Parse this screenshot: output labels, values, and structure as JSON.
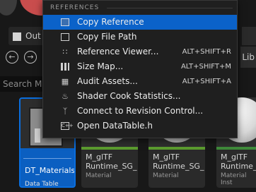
{
  "background": {
    "tab_label": "Out",
    "search_label": "Search M",
    "right_label": "Lib"
  },
  "tiles": [
    {
      "name": "DT_Materials",
      "type": "Data Table (OK..."
    },
    {
      "name": "M_glTF\nRuntime_SG_",
      "type": "Material"
    },
    {
      "name": "M_glTF\nRuntime_SG_",
      "type": "Material"
    },
    {
      "name": "M_glTF\nRuntime_",
      "type": "Material Inst"
    }
  ],
  "menu": {
    "header": "REFERENCES",
    "items": [
      {
        "label": "Copy Reference",
        "shortcut": "",
        "icon": "copy-reference-icon",
        "selected": true
      },
      {
        "label": "Copy File Path",
        "shortcut": "",
        "icon": "copy-file-path-icon",
        "selected": false
      },
      {
        "label": "Reference Viewer...",
        "shortcut": "ALT+SHIFT+R",
        "icon": "reference-viewer-icon",
        "selected": false
      },
      {
        "label": "Size Map...",
        "shortcut": "ALT+SHIFT+M",
        "icon": "size-map-icon",
        "selected": false
      },
      {
        "label": "Audit Assets...",
        "shortcut": "ALT+SHIFT+A",
        "icon": "audit-assets-icon",
        "selected": false
      },
      {
        "label": "Shader Cook Statistics...",
        "shortcut": "",
        "icon": "shader-cook-statistics-icon",
        "selected": false
      },
      {
        "label": "Connect to Revision Control...",
        "shortcut": "",
        "icon": "revision-control-icon",
        "selected": false
      },
      {
        "label": "Open DataTable.h",
        "shortcut": "",
        "icon": "open-datatable-icon",
        "selected": false
      }
    ]
  },
  "colors": {
    "selection": "#0b62c9",
    "menu_bg": "#1f1f1f",
    "material_bar": "#5b9c2f"
  }
}
